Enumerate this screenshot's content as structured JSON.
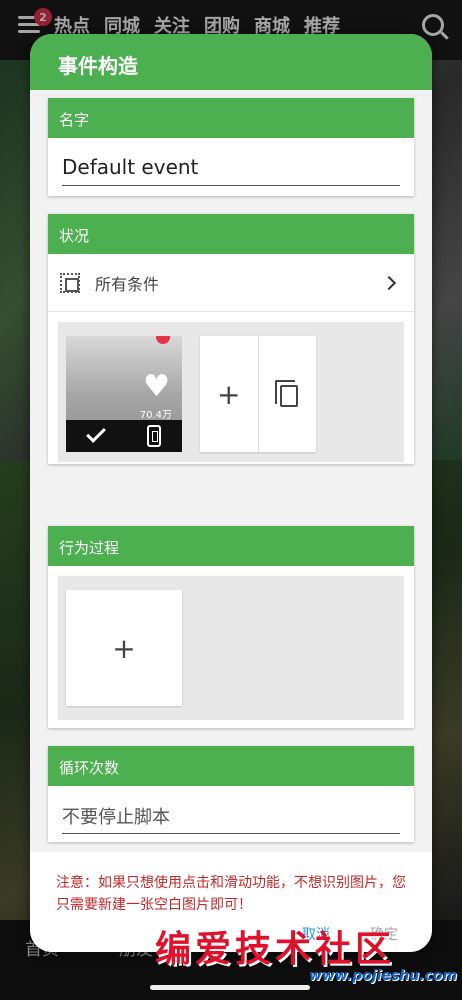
{
  "background_app": {
    "notification_count": "2",
    "nav_tabs": [
      "热点",
      "同城",
      "关注",
      "团购",
      "商城",
      "推荐"
    ],
    "bottom_tabs": [
      "首页",
      "朋友"
    ]
  },
  "dialog": {
    "title": "事件构造",
    "name_section": {
      "header": "名字",
      "value": "Default event"
    },
    "condition_section": {
      "header": "状况",
      "row_label": "所有条件",
      "thumbnail_count": "70.4万",
      "add_symbol": "+"
    },
    "action_section": {
      "header": "行为过程",
      "add_symbol": "+"
    },
    "loop_section": {
      "header": "循环次数",
      "value": "不要停止脚本"
    },
    "note": "注意：如果只想使用点击和滑动功能，不想识别图片，您只需要新建一张空白图片即可！",
    "cancel_label": "取消",
    "ok_label": "确定"
  },
  "watermark": {
    "text": "编爱技术社区",
    "url": "www.pojieshu.com"
  },
  "colors": {
    "header_green": "#4caf50",
    "note_red": "#c62828",
    "cancel_blue": "#2196f3",
    "ok_gray": "#9e9e9e"
  }
}
